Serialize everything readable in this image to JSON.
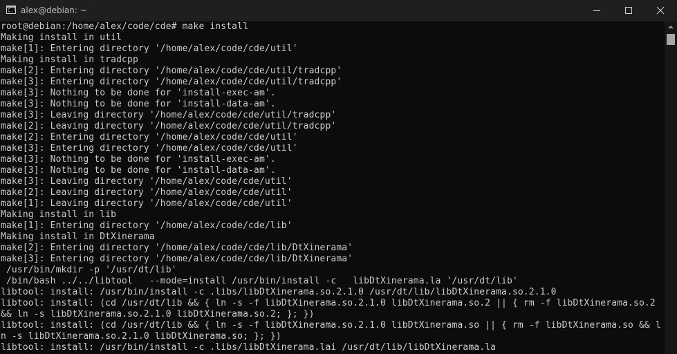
{
  "window": {
    "title": "alex@debian: ~",
    "app_icon_text": "C:\\",
    "controls": {
      "minimize": "minimize-icon",
      "maximize": "maximize-icon",
      "close": "close-icon"
    }
  },
  "terminal": {
    "lines": [
      "root@debian:/home/alex/code/cde# make install",
      "Making install in util",
      "make[1]: Entering directory '/home/alex/code/cde/util'",
      "Making install in tradcpp",
      "make[2]: Entering directory '/home/alex/code/cde/util/tradcpp'",
      "make[3]: Entering directory '/home/alex/code/cde/util/tradcpp'",
      "make[3]: Nothing to be done for 'install-exec-am'.",
      "make[3]: Nothing to be done for 'install-data-am'.",
      "make[3]: Leaving directory '/home/alex/code/cde/util/tradcpp'",
      "make[2]: Leaving directory '/home/alex/code/cde/util/tradcpp'",
      "make[2]: Entering directory '/home/alex/code/cde/util'",
      "make[3]: Entering directory '/home/alex/code/cde/util'",
      "make[3]: Nothing to be done for 'install-exec-am'.",
      "make[3]: Nothing to be done for 'install-data-am'.",
      "make[3]: Leaving directory '/home/alex/code/cde/util'",
      "make[2]: Leaving directory '/home/alex/code/cde/util'",
      "make[1]: Leaving directory '/home/alex/code/cde/util'",
      "Making install in lib",
      "make[1]: Entering directory '/home/alex/code/cde/lib'",
      "Making install in DtXinerama",
      "make[2]: Entering directory '/home/alex/code/cde/lib/DtXinerama'",
      "make[3]: Entering directory '/home/alex/code/cde/lib/DtXinerama'",
      " /usr/bin/mkdir -p '/usr/dt/lib'",
      " /bin/bash ../../libtool   --mode=install /usr/bin/install -c   libDtXinerama.la '/usr/dt/lib'",
      "libtool: install: /usr/bin/install -c .libs/libDtXinerama.so.2.1.0 /usr/dt/lib/libDtXinerama.so.2.1.0",
      "libtool: install: (cd /usr/dt/lib && { ln -s -f libDtXinerama.so.2.1.0 libDtXinerama.so.2 || { rm -f libDtXinerama.so.2",
      "&& ln -s libDtXinerama.so.2.1.0 libDtXinerama.so.2; }; })",
      "libtool: install: (cd /usr/dt/lib && { ln -s -f libDtXinerama.so.2.1.0 libDtXinerama.so || { rm -f libDtXinerama.so && l",
      "n -s libDtXinerama.so.2.1.0 libDtXinerama.so; }; })",
      "libtool: install: /usr/bin/install -c .libs/libDtXinerama.lai /usr/dt/lib/libDtXinerama.la"
    ]
  },
  "scrollbar": {
    "up_arrow": "scroll-up-arrow-icon"
  },
  "colors": {
    "background": "#0c0c0c",
    "foreground": "#cccccc",
    "titlebar": "#1f1f1f"
  }
}
